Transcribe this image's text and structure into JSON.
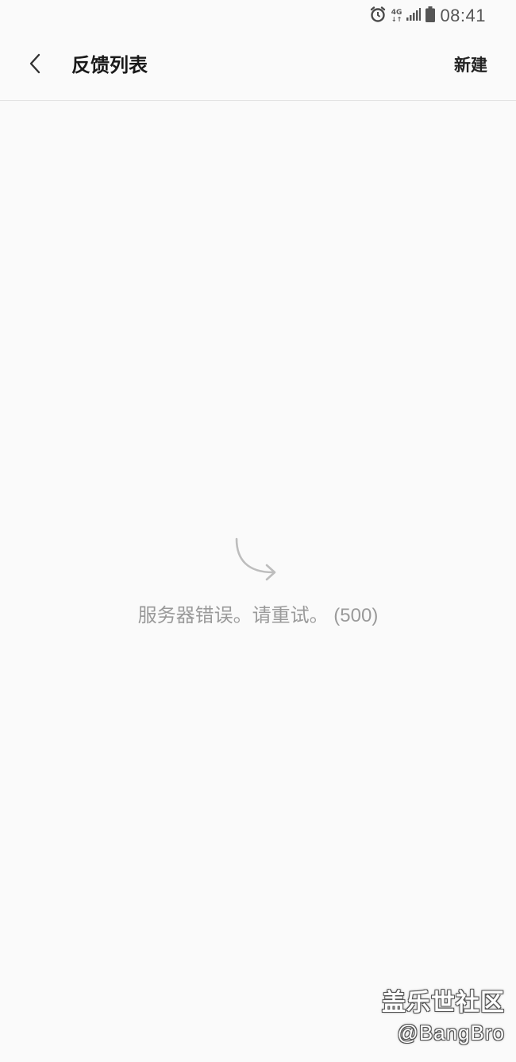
{
  "status_bar": {
    "time": "08:41",
    "network": "4G",
    "icons": [
      "alarm-icon",
      "network-4g-icon",
      "signal-icon",
      "battery-icon"
    ]
  },
  "app_bar": {
    "back_icon": "chevron-left-icon",
    "title": "反馈列表",
    "action_label": "新建"
  },
  "error_state": {
    "icon": "redo-arrow-icon",
    "message": "服务器错误。请重试。 (500)"
  },
  "watermark": {
    "site": "盖乐世社区",
    "user": "@BangBro"
  },
  "colors": {
    "background": "#fafafa",
    "title_text": "#1a1a1a",
    "message_text": "#9a9a9a",
    "icon_gray": "#bdbdbd"
  }
}
